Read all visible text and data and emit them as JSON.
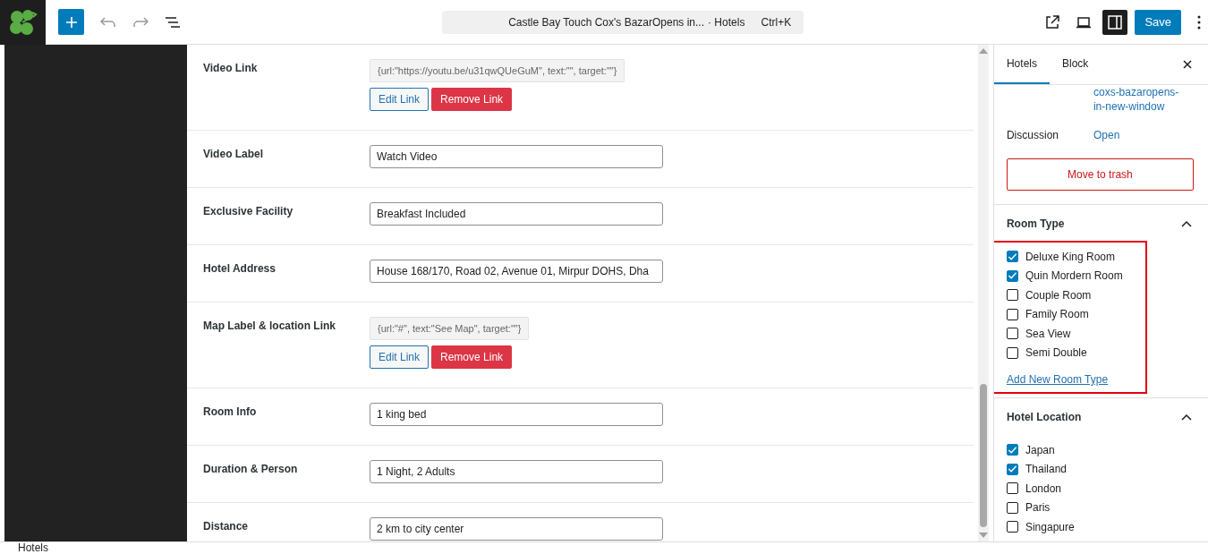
{
  "toolbar": {
    "command_bar": {
      "title": "Castle Bay Touch Cox's BazarOpens in...",
      "post_type": "· Hotels",
      "shortcut": "Ctrl+K"
    },
    "settings_toggle_selected": true,
    "save": "Save"
  },
  "fields": [
    {
      "label": "Video Link",
      "kind": "link",
      "value": "{url:\"https://youtu.be/u31qwQUeGuM\", text:\"\", target:\"\"}",
      "buttons": [
        "Edit Link",
        "Remove Link"
      ]
    },
    {
      "label": "Video Label",
      "kind": "text",
      "value": "Watch Video"
    },
    {
      "label": "Exclusive Facility",
      "kind": "text",
      "value": "Breakfast Included"
    },
    {
      "label": "Hotel Address",
      "kind": "text",
      "value": "House 168/170, Road 02, Avenue 01, Mirpur DOHS, Dha"
    },
    {
      "label": "Map Label & location Link",
      "kind": "link",
      "value": "{url:\"#\", text:\"See Map\", target:\"\"}",
      "buttons": [
        "Edit Link",
        "Remove Link"
      ]
    },
    {
      "label": "Room Info",
      "kind": "text",
      "value": "1 king bed"
    },
    {
      "label": "Duration & Person",
      "kind": "text",
      "value": "1 Night, 2 Adults"
    },
    {
      "label": "Distance",
      "kind": "text",
      "value": "2 km to city center"
    }
  ],
  "sidebar": {
    "tabs": [
      {
        "label": "Hotels",
        "selected": true
      },
      {
        "label": "Block",
        "selected": false
      }
    ],
    "slug_link": [
      "coxs-bazaropens-",
      "in-new-window"
    ],
    "discussion": {
      "label": "Discussion",
      "value": "Open"
    },
    "trash_button": "Move to trash",
    "panels": [
      {
        "title": "Room Type",
        "expanded": true,
        "highlighted": true,
        "items": [
          {
            "label": "Deluxe King Room",
            "checked": true
          },
          {
            "label": "Quin Mordern Room",
            "checked": true
          },
          {
            "label": "Couple Room",
            "checked": false
          },
          {
            "label": "Family Room",
            "checked": false
          },
          {
            "label": "Sea View",
            "checked": false
          },
          {
            "label": "Semi Double",
            "checked": false
          }
        ],
        "add_link": "Add New Room Type"
      },
      {
        "title": "Hotel Location",
        "expanded": true,
        "highlighted": false,
        "items": [
          {
            "label": "Japan",
            "checked": true
          },
          {
            "label": "Thailand",
            "checked": true
          },
          {
            "label": "London",
            "checked": false
          },
          {
            "label": "Paris",
            "checked": false
          },
          {
            "label": "Singapure",
            "checked": false
          }
        ]
      }
    ]
  },
  "footer": {
    "breadcrumb": "Hotels"
  }
}
